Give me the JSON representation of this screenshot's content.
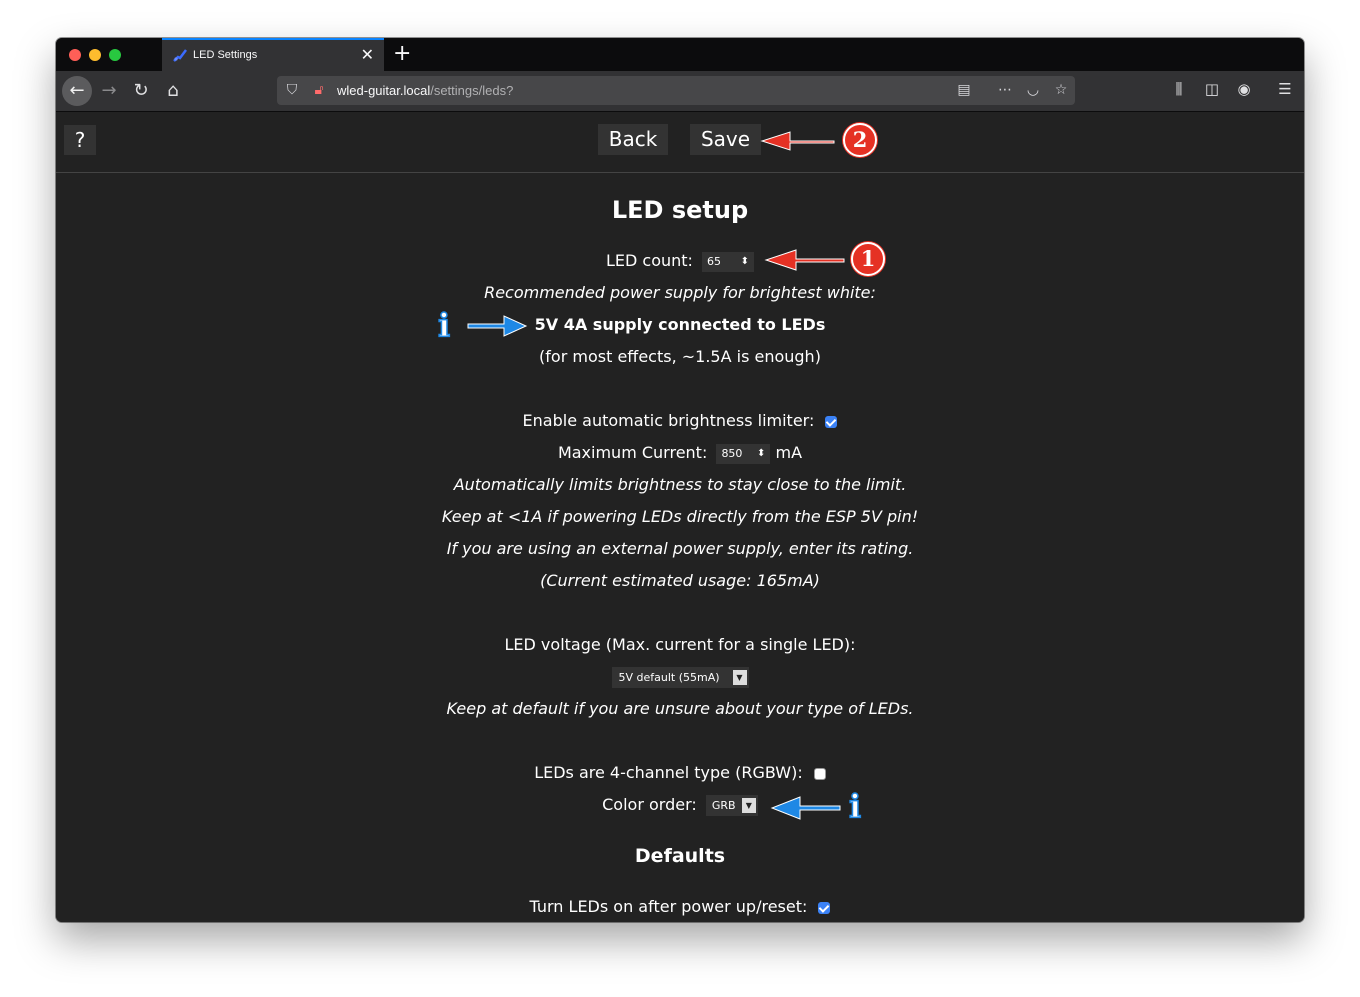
{
  "browser": {
    "tab_title": "LED Settings",
    "url_host": "wled-guitar.local",
    "url_path": "/settings/leds?"
  },
  "nav": {
    "help_label": "?",
    "back_label": "Back",
    "save_label": "Save"
  },
  "page": {
    "title": "LED setup",
    "led_count_label": "LED count:",
    "led_count_value": "65",
    "rec_supply_label": "Recommended power supply for brightest white:",
    "supply_value": "5V 4A supply connected to LEDs",
    "supply_note": "(for most effects, ~1.5A is enough)",
    "abl_label": "Enable automatic brightness limiter:",
    "abl_checked": true,
    "max_current_label": "Maximum Current:",
    "max_current_value": "850",
    "max_current_unit": "mA",
    "abl_note1": "Automatically limits brightness to stay close to the limit.",
    "abl_note2": "Keep at <1A if powering LEDs directly from the ESP 5V pin!",
    "abl_note3": "If you are using an external power supply, enter its rating.",
    "abl_note4": "(Current estimated usage: 165mA)",
    "voltage_label": "LED voltage (Max. current for a single LED):",
    "voltage_selected": "5V default (55mA)",
    "voltage_note": "Keep at default if you are unsure about your type of LEDs.",
    "rgbw_label": "LEDs are 4-channel type (RGBW):",
    "rgbw_checked": false,
    "color_order_label": "Color order:",
    "color_order_selected": "GRB",
    "defaults_heading": "Defaults",
    "turn_on_label": "Turn LEDs on after power up/reset:",
    "turn_on_checked": true
  },
  "annotations": {
    "badge_1": "1",
    "badge_2": "2",
    "info_glyph": "i",
    "red_color": "#e53124",
    "blue_color": "#1e88e5"
  }
}
